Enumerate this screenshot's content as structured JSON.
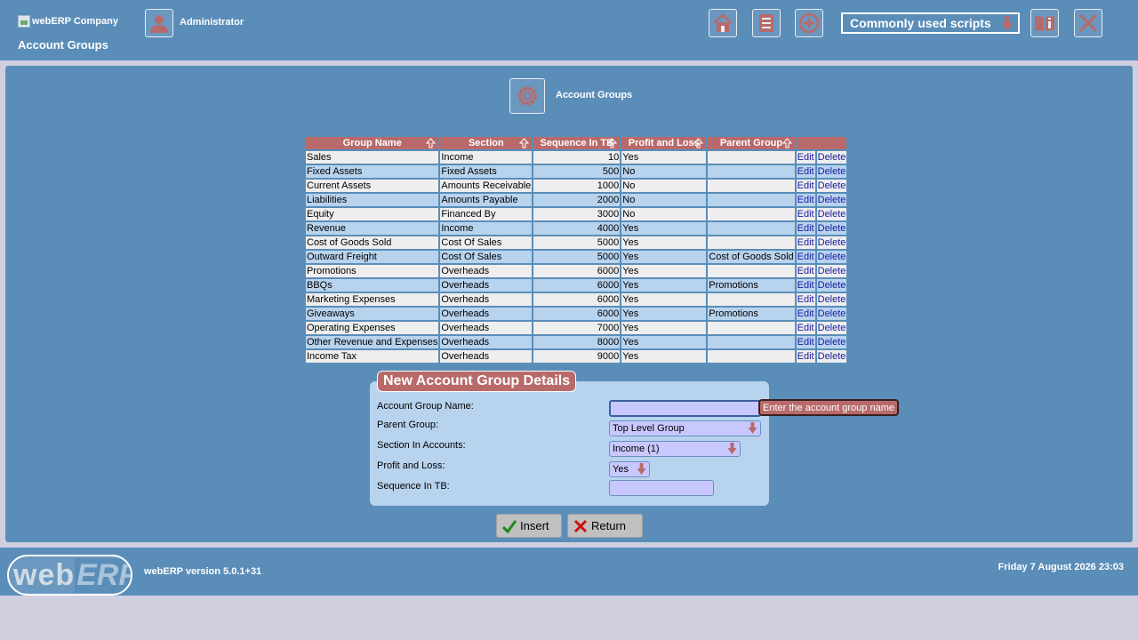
{
  "header": {
    "company": "webERP Company",
    "page_title": "Account Groups",
    "user_name": "Administrator",
    "scripts_select": "Commonly used scripts"
  },
  "main": {
    "title": "Account Groups"
  },
  "table": {
    "columns": [
      "Group Name",
      "Section",
      "Sequence In TB",
      "Profit and Loss",
      "Parent Group",
      ""
    ],
    "rows": [
      {
        "name": "Sales",
        "section": "Income",
        "seq": "10",
        "pl": "Yes",
        "parent": ""
      },
      {
        "name": "Fixed Assets",
        "section": "Fixed Assets",
        "seq": "500",
        "pl": "No",
        "parent": ""
      },
      {
        "name": "Current Assets",
        "section": "Amounts Receivable",
        "seq": "1000",
        "pl": "No",
        "parent": ""
      },
      {
        "name": "Liabilities",
        "section": "Amounts Payable",
        "seq": "2000",
        "pl": "No",
        "parent": ""
      },
      {
        "name": "Equity",
        "section": "Financed By",
        "seq": "3000",
        "pl": "No",
        "parent": ""
      },
      {
        "name": "Revenue",
        "section": "Income",
        "seq": "4000",
        "pl": "Yes",
        "parent": ""
      },
      {
        "name": "Cost of Goods Sold",
        "section": "Cost Of Sales",
        "seq": "5000",
        "pl": "Yes",
        "parent": ""
      },
      {
        "name": "Outward Freight",
        "section": "Cost Of Sales",
        "seq": "5000",
        "pl": "Yes",
        "parent": "Cost of Goods Sold"
      },
      {
        "name": "Promotions",
        "section": "Overheads",
        "seq": "6000",
        "pl": "Yes",
        "parent": ""
      },
      {
        "name": "BBQs",
        "section": "Overheads",
        "seq": "6000",
        "pl": "Yes",
        "parent": "Promotions"
      },
      {
        "name": "Marketing Expenses",
        "section": "Overheads",
        "seq": "6000",
        "pl": "Yes",
        "parent": ""
      },
      {
        "name": "Giveaways",
        "section": "Overheads",
        "seq": "6000",
        "pl": "Yes",
        "parent": "Promotions"
      },
      {
        "name": "Operating Expenses",
        "section": "Overheads",
        "seq": "7000",
        "pl": "Yes",
        "parent": ""
      },
      {
        "name": "Other Revenue and Expenses",
        "section": "Overheads",
        "seq": "8000",
        "pl": "Yes",
        "parent": ""
      },
      {
        "name": "Income Tax",
        "section": "Overheads",
        "seq": "9000",
        "pl": "Yes",
        "parent": ""
      }
    ],
    "edit_label": "Edit",
    "delete_label": "Delete"
  },
  "form": {
    "legend": "New Account Group Details",
    "name_label": "Account Group Name:",
    "name_value": "",
    "name_hint": "Enter the account group name",
    "parent_label": "Parent Group:",
    "parent_value": "Top Level Group",
    "section_label": "Section In Accounts:",
    "section_value": "Income (1)",
    "pl_label": "Profit and Loss:",
    "pl_value": "Yes",
    "seq_label": "Sequence In TB:",
    "seq_value": "",
    "insert_label": "Insert",
    "return_label": "Return"
  },
  "footer": {
    "logo_web": "web",
    "logo_erp": "ERP",
    "version": "webERP version 5.0.1+31",
    "datetime": "Friday 7 August 2026 23:03"
  },
  "colors": {
    "header_bg": "#5a8db8",
    "accent": "#b86a6a",
    "row_alt": "#b8d3ee"
  }
}
